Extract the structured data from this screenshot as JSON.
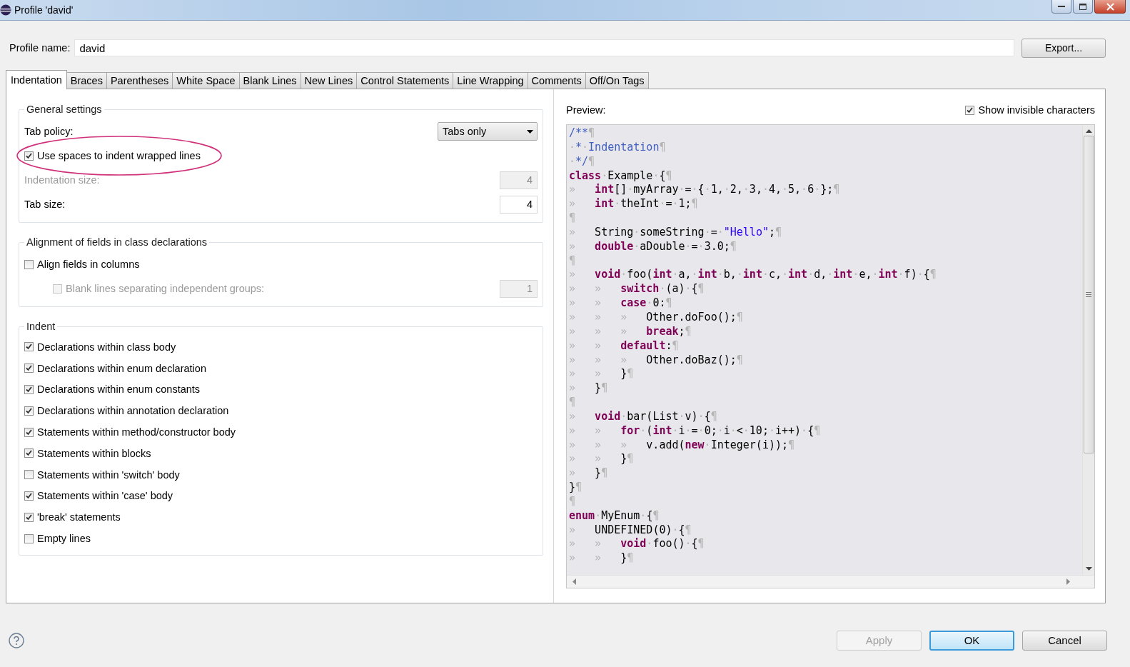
{
  "window": {
    "title": "Profile 'david'"
  },
  "profile": {
    "label": "Profile name:",
    "value": "david",
    "export_button": "Export..."
  },
  "tabs": [
    {
      "label": "Indentation",
      "selected": true
    },
    {
      "label": "Braces",
      "selected": false
    },
    {
      "label": "Parentheses",
      "selected": false
    },
    {
      "label": "White Space",
      "selected": false
    },
    {
      "label": "Blank Lines",
      "selected": false
    },
    {
      "label": "New Lines",
      "selected": false
    },
    {
      "label": "Control Statements",
      "selected": false
    },
    {
      "label": "Line Wrapping",
      "selected": false
    },
    {
      "label": "Comments",
      "selected": false
    },
    {
      "label": "Off/On Tags",
      "selected": false
    }
  ],
  "groups": [
    {
      "title": "General settings",
      "rows": [
        {
          "kind": "select",
          "label": "Tab policy:",
          "value": "Tabs only",
          "disabled": false
        },
        {
          "kind": "checkbox",
          "label": "Use spaces to indent wrapped lines",
          "checked": true,
          "disabled": false,
          "annotated": true
        },
        {
          "kind": "number",
          "label": "Indentation size:",
          "value": "4",
          "disabled": true
        },
        {
          "kind": "number",
          "label": "Tab size:",
          "value": "4",
          "disabled": false
        }
      ]
    },
    {
      "title": "Alignment of fields in class declarations",
      "rows": [
        {
          "kind": "checkbox",
          "label": "Align fields in columns",
          "checked": false,
          "disabled": false,
          "annotated": false
        },
        {
          "kind": "checkbox_number",
          "label": "Blank lines separating independent groups:",
          "checked": false,
          "disabled": true,
          "value": "1"
        }
      ]
    },
    {
      "title": "Indent",
      "rows": [
        {
          "kind": "checkbox",
          "label": "Declarations within class body",
          "checked": true,
          "disabled": false,
          "annotated": false
        },
        {
          "kind": "checkbox",
          "label": "Declarations within enum declaration",
          "checked": true,
          "disabled": false,
          "annotated": false
        },
        {
          "kind": "checkbox",
          "label": "Declarations within enum constants",
          "checked": true,
          "disabled": false,
          "annotated": false
        },
        {
          "kind": "checkbox",
          "label": "Declarations within annotation declaration",
          "checked": true,
          "disabled": false,
          "annotated": false
        },
        {
          "kind": "checkbox",
          "label": "Statements within method/constructor body",
          "checked": true,
          "disabled": false,
          "annotated": false
        },
        {
          "kind": "checkbox",
          "label": "Statements within blocks",
          "checked": true,
          "disabled": false,
          "annotated": false
        },
        {
          "kind": "checkbox",
          "label": "Statements within 'switch' body",
          "checked": false,
          "disabled": false,
          "annotated": false
        },
        {
          "kind": "checkbox",
          "label": "Statements within 'case' body",
          "checked": true,
          "disabled": false,
          "annotated": false
        },
        {
          "kind": "checkbox",
          "label": "'break' statements",
          "checked": true,
          "disabled": false,
          "annotated": false
        },
        {
          "kind": "checkbox",
          "label": "Empty lines",
          "checked": false,
          "disabled": false,
          "annotated": false
        }
      ]
    }
  ],
  "preview": {
    "label": "Preview:",
    "show_invisible": {
      "label": "Show invisible characters",
      "checked": true
    },
    "lines": [
      [
        {
          "kind": "comment",
          "text": "/**"
        },
        {
          "kind": "mark",
          "text": "¶"
        }
      ],
      [
        {
          "kind": "mark",
          "text": "·"
        },
        {
          "kind": "comment",
          "text": "*"
        },
        {
          "kind": "mark",
          "text": "·"
        },
        {
          "kind": "comment",
          "text": "Indentation"
        },
        {
          "kind": "mark",
          "text": "¶"
        }
      ],
      [
        {
          "kind": "mark",
          "text": "·"
        },
        {
          "kind": "comment",
          "text": "*/"
        },
        {
          "kind": "mark",
          "text": "¶"
        }
      ],
      [
        {
          "kind": "kw",
          "text": "class"
        },
        {
          "kind": "mark",
          "text": "·"
        },
        {
          "kind": "plain",
          "text": "Example"
        },
        {
          "kind": "mark",
          "text": "·"
        },
        {
          "kind": "plain",
          "text": "{"
        },
        {
          "kind": "mark",
          "text": "¶"
        }
      ],
      [
        {
          "kind": "tab",
          "text": "»"
        },
        {
          "kind": "kw",
          "text": "int"
        },
        {
          "kind": "plain",
          "text": "[]"
        },
        {
          "kind": "mark",
          "text": "·"
        },
        {
          "kind": "plain",
          "text": "myArray"
        },
        {
          "kind": "mark",
          "text": "·"
        },
        {
          "kind": "plain",
          "text": "="
        },
        {
          "kind": "mark",
          "text": "·"
        },
        {
          "kind": "plain",
          "text": "{"
        },
        {
          "kind": "mark",
          "text": "·"
        },
        {
          "kind": "plain",
          "text": "1,"
        },
        {
          "kind": "mark",
          "text": "·"
        },
        {
          "kind": "plain",
          "text": "2,"
        },
        {
          "kind": "mark",
          "text": "·"
        },
        {
          "kind": "plain",
          "text": "3,"
        },
        {
          "kind": "mark",
          "text": "·"
        },
        {
          "kind": "plain",
          "text": "4,"
        },
        {
          "kind": "mark",
          "text": "·"
        },
        {
          "kind": "plain",
          "text": "5,"
        },
        {
          "kind": "mark",
          "text": "·"
        },
        {
          "kind": "plain",
          "text": "6"
        },
        {
          "kind": "mark",
          "text": "·"
        },
        {
          "kind": "plain",
          "text": "};"
        },
        {
          "kind": "mark",
          "text": "¶"
        }
      ],
      [
        {
          "kind": "tab",
          "text": "»"
        },
        {
          "kind": "kw",
          "text": "int"
        },
        {
          "kind": "mark",
          "text": "·"
        },
        {
          "kind": "plain",
          "text": "theInt"
        },
        {
          "kind": "mark",
          "text": "·"
        },
        {
          "kind": "plain",
          "text": "="
        },
        {
          "kind": "mark",
          "text": "·"
        },
        {
          "kind": "plain",
          "text": "1;"
        },
        {
          "kind": "mark",
          "text": "¶"
        }
      ],
      [
        {
          "kind": "mark",
          "text": "¶"
        }
      ],
      [
        {
          "kind": "tab",
          "text": "»"
        },
        {
          "kind": "plain",
          "text": "String"
        },
        {
          "kind": "mark",
          "text": "·"
        },
        {
          "kind": "plain",
          "text": "someString"
        },
        {
          "kind": "mark",
          "text": "·"
        },
        {
          "kind": "plain",
          "text": "="
        },
        {
          "kind": "mark",
          "text": "·"
        },
        {
          "kind": "string",
          "text": "\"Hello\""
        },
        {
          "kind": "plain",
          "text": ";"
        },
        {
          "kind": "mark",
          "text": "¶"
        }
      ],
      [
        {
          "kind": "tab",
          "text": "»"
        },
        {
          "kind": "kw",
          "text": "double"
        },
        {
          "kind": "mark",
          "text": "·"
        },
        {
          "kind": "plain",
          "text": "aDouble"
        },
        {
          "kind": "mark",
          "text": "·"
        },
        {
          "kind": "plain",
          "text": "="
        },
        {
          "kind": "mark",
          "text": "·"
        },
        {
          "kind": "plain",
          "text": "3.0;"
        },
        {
          "kind": "mark",
          "text": "¶"
        }
      ],
      [
        {
          "kind": "mark",
          "text": "¶"
        }
      ],
      [
        {
          "kind": "tab",
          "text": "»"
        },
        {
          "kind": "kw",
          "text": "void"
        },
        {
          "kind": "mark",
          "text": "·"
        },
        {
          "kind": "plain",
          "text": "foo("
        },
        {
          "kind": "kw",
          "text": "int"
        },
        {
          "kind": "mark",
          "text": "·"
        },
        {
          "kind": "plain",
          "text": "a,"
        },
        {
          "kind": "mark",
          "text": "·"
        },
        {
          "kind": "kw",
          "text": "int"
        },
        {
          "kind": "mark",
          "text": "·"
        },
        {
          "kind": "plain",
          "text": "b,"
        },
        {
          "kind": "mark",
          "text": "·"
        },
        {
          "kind": "kw",
          "text": "int"
        },
        {
          "kind": "mark",
          "text": "·"
        },
        {
          "kind": "plain",
          "text": "c,"
        },
        {
          "kind": "mark",
          "text": "·"
        },
        {
          "kind": "kw",
          "text": "int"
        },
        {
          "kind": "mark",
          "text": "·"
        },
        {
          "kind": "plain",
          "text": "d,"
        },
        {
          "kind": "mark",
          "text": "·"
        },
        {
          "kind": "kw",
          "text": "int"
        },
        {
          "kind": "mark",
          "text": "·"
        },
        {
          "kind": "plain",
          "text": "e,"
        },
        {
          "kind": "mark",
          "text": "·"
        },
        {
          "kind": "kw",
          "text": "int"
        },
        {
          "kind": "mark",
          "text": "·"
        },
        {
          "kind": "plain",
          "text": "f)"
        },
        {
          "kind": "mark",
          "text": "·"
        },
        {
          "kind": "plain",
          "text": "{"
        },
        {
          "kind": "mark",
          "text": "¶"
        }
      ],
      [
        {
          "kind": "tab",
          "text": "»"
        },
        {
          "kind": "tab",
          "text": "»"
        },
        {
          "kind": "kw",
          "text": "switch"
        },
        {
          "kind": "mark",
          "text": "·"
        },
        {
          "kind": "plain",
          "text": "(a)"
        },
        {
          "kind": "mark",
          "text": "·"
        },
        {
          "kind": "plain",
          "text": "{"
        },
        {
          "kind": "mark",
          "text": "¶"
        }
      ],
      [
        {
          "kind": "tab",
          "text": "»"
        },
        {
          "kind": "tab",
          "text": "»"
        },
        {
          "kind": "kw",
          "text": "case"
        },
        {
          "kind": "mark",
          "text": "·"
        },
        {
          "kind": "plain",
          "text": "0:"
        },
        {
          "kind": "mark",
          "text": "¶"
        }
      ],
      [
        {
          "kind": "tab",
          "text": "»"
        },
        {
          "kind": "tab",
          "text": "»"
        },
        {
          "kind": "tab",
          "text": "»"
        },
        {
          "kind": "plain",
          "text": "Other.doFoo();"
        },
        {
          "kind": "mark",
          "text": "¶"
        }
      ],
      [
        {
          "kind": "tab",
          "text": "»"
        },
        {
          "kind": "tab",
          "text": "»"
        },
        {
          "kind": "tab",
          "text": "»"
        },
        {
          "kind": "kw",
          "text": "break"
        },
        {
          "kind": "plain",
          "text": ";"
        },
        {
          "kind": "mark",
          "text": "¶"
        }
      ],
      [
        {
          "kind": "tab",
          "text": "»"
        },
        {
          "kind": "tab",
          "text": "»"
        },
        {
          "kind": "kw",
          "text": "default"
        },
        {
          "kind": "plain",
          "text": ":"
        },
        {
          "kind": "mark",
          "text": "¶"
        }
      ],
      [
        {
          "kind": "tab",
          "text": "»"
        },
        {
          "kind": "tab",
          "text": "»"
        },
        {
          "kind": "tab",
          "text": "»"
        },
        {
          "kind": "plain",
          "text": "Other.doBaz();"
        },
        {
          "kind": "mark",
          "text": "¶"
        }
      ],
      [
        {
          "kind": "tab",
          "text": "»"
        },
        {
          "kind": "tab",
          "text": "»"
        },
        {
          "kind": "plain",
          "text": "}"
        },
        {
          "kind": "mark",
          "text": "¶"
        }
      ],
      [
        {
          "kind": "tab",
          "text": "»"
        },
        {
          "kind": "plain",
          "text": "}"
        },
        {
          "kind": "mark",
          "text": "¶"
        }
      ],
      [
        {
          "kind": "mark",
          "text": "¶"
        }
      ],
      [
        {
          "kind": "tab",
          "text": "»"
        },
        {
          "kind": "kw",
          "text": "void"
        },
        {
          "kind": "mark",
          "text": "·"
        },
        {
          "kind": "plain",
          "text": "bar(List"
        },
        {
          "kind": "mark",
          "text": "·"
        },
        {
          "kind": "plain",
          "text": "v)"
        },
        {
          "kind": "mark",
          "text": "·"
        },
        {
          "kind": "plain",
          "text": "{"
        },
        {
          "kind": "mark",
          "text": "¶"
        }
      ],
      [
        {
          "kind": "tab",
          "text": "»"
        },
        {
          "kind": "tab",
          "text": "»"
        },
        {
          "kind": "kw",
          "text": "for"
        },
        {
          "kind": "mark",
          "text": "·"
        },
        {
          "kind": "plain",
          "text": "("
        },
        {
          "kind": "kw",
          "text": "int"
        },
        {
          "kind": "mark",
          "text": "·"
        },
        {
          "kind": "plain",
          "text": "i"
        },
        {
          "kind": "mark",
          "text": "·"
        },
        {
          "kind": "plain",
          "text": "="
        },
        {
          "kind": "mark",
          "text": "·"
        },
        {
          "kind": "plain",
          "text": "0;"
        },
        {
          "kind": "mark",
          "text": "·"
        },
        {
          "kind": "plain",
          "text": "i"
        },
        {
          "kind": "mark",
          "text": "·"
        },
        {
          "kind": "plain",
          "text": "<"
        },
        {
          "kind": "mark",
          "text": "·"
        },
        {
          "kind": "plain",
          "text": "10;"
        },
        {
          "kind": "mark",
          "text": "·"
        },
        {
          "kind": "plain",
          "text": "i++)"
        },
        {
          "kind": "mark",
          "text": "·"
        },
        {
          "kind": "plain",
          "text": "{"
        },
        {
          "kind": "mark",
          "text": "¶"
        }
      ],
      [
        {
          "kind": "tab",
          "text": "»"
        },
        {
          "kind": "tab",
          "text": "»"
        },
        {
          "kind": "tab",
          "text": "»"
        },
        {
          "kind": "plain",
          "text": "v.add("
        },
        {
          "kind": "kw",
          "text": "new"
        },
        {
          "kind": "mark",
          "text": "·"
        },
        {
          "kind": "plain",
          "text": "Integer(i));"
        },
        {
          "kind": "mark",
          "text": "¶"
        }
      ],
      [
        {
          "kind": "tab",
          "text": "»"
        },
        {
          "kind": "tab",
          "text": "»"
        },
        {
          "kind": "plain",
          "text": "}"
        },
        {
          "kind": "mark",
          "text": "¶"
        }
      ],
      [
        {
          "kind": "tab",
          "text": "»"
        },
        {
          "kind": "plain",
          "text": "}"
        },
        {
          "kind": "mark",
          "text": "¶"
        }
      ],
      [
        {
          "kind": "plain",
          "text": "}"
        },
        {
          "kind": "mark",
          "text": "¶"
        }
      ],
      [
        {
          "kind": "mark",
          "text": "¶"
        }
      ],
      [
        {
          "kind": "kw",
          "text": "enum"
        },
        {
          "kind": "mark",
          "text": "·"
        },
        {
          "kind": "plain",
          "text": "MyEnum"
        },
        {
          "kind": "mark",
          "text": "·"
        },
        {
          "kind": "plain",
          "text": "{"
        },
        {
          "kind": "mark",
          "text": "¶"
        }
      ],
      [
        {
          "kind": "tab",
          "text": "»"
        },
        {
          "kind": "plain",
          "text": "UNDEFINED(0)"
        },
        {
          "kind": "mark",
          "text": "·"
        },
        {
          "kind": "plain",
          "text": "{"
        },
        {
          "kind": "mark",
          "text": "¶"
        }
      ],
      [
        {
          "kind": "tab",
          "text": "»"
        },
        {
          "kind": "tab",
          "text": "»"
        },
        {
          "kind": "kw",
          "text": "void"
        },
        {
          "kind": "mark",
          "text": "·"
        },
        {
          "kind": "plain",
          "text": "foo()"
        },
        {
          "kind": "mark",
          "text": "·"
        },
        {
          "kind": "plain",
          "text": "{"
        },
        {
          "kind": "mark",
          "text": "¶"
        }
      ],
      [
        {
          "kind": "tab",
          "text": "»"
        },
        {
          "kind": "tab",
          "text": "»"
        },
        {
          "kind": "plain",
          "text": "}"
        },
        {
          "kind": "mark",
          "text": "¶"
        }
      ]
    ]
  },
  "buttons": [
    {
      "label": "Apply",
      "disabled": true,
      "default": false
    },
    {
      "label": "OK",
      "disabled": false,
      "default": true
    },
    {
      "label": "Cancel",
      "disabled": false,
      "default": false
    }
  ]
}
